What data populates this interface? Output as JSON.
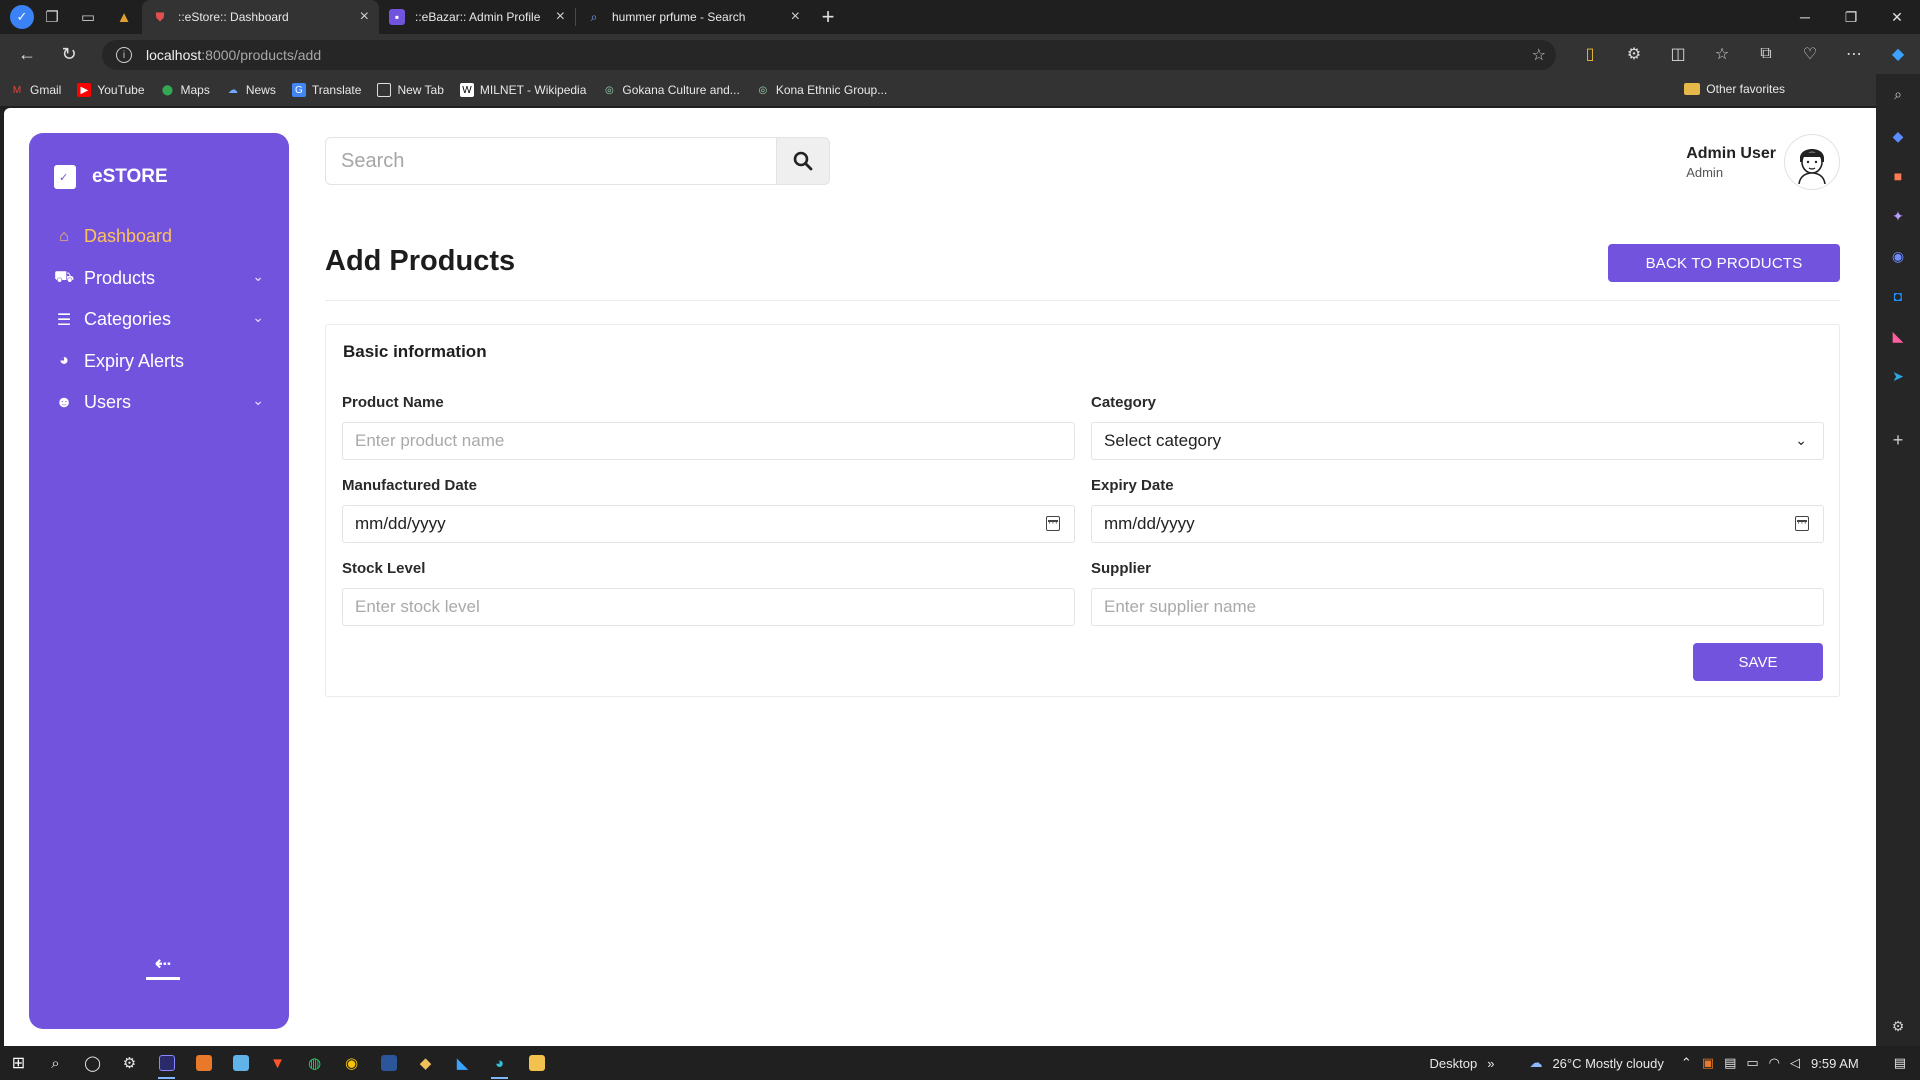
{
  "browser": {
    "tabs": [
      {
        "title": "::eStore:: Dashboard",
        "active": true
      },
      {
        "title": "::eBazar:: Admin Profile",
        "active": false
      },
      {
        "title": "hummer prfume - Search",
        "active": false
      }
    ],
    "url_host": "localhost",
    "url_rest": ":8000/products/add",
    "bookmarks": [
      "Gmail",
      "YouTube",
      "Maps",
      "News",
      "Translate",
      "New Tab",
      "MILNET - Wikipedia",
      "Gokana Culture and...",
      "Kona Ethnic Group..."
    ],
    "other_favorites": "Other favorites"
  },
  "sidebar": {
    "brand": "eSTORE",
    "items": [
      {
        "label": "Dashboard",
        "icon": "home-icon",
        "active": true,
        "expandable": false
      },
      {
        "label": "Products",
        "icon": "truck-icon",
        "active": false,
        "expandable": true
      },
      {
        "label": "Categories",
        "icon": "hierarchy-icon",
        "active": false,
        "expandable": true
      },
      {
        "label": "Expiry Alerts",
        "icon": "palette-icon",
        "active": false,
        "expandable": false
      },
      {
        "label": "Users",
        "icon": "user-icon",
        "active": false,
        "expandable": true
      }
    ]
  },
  "header": {
    "search_placeholder": "Search",
    "user_name": "Admin User",
    "user_role": "Admin"
  },
  "page": {
    "title": "Add Products",
    "back_label": "BACK TO PRODUCTS",
    "section_title": "Basic information",
    "fields": {
      "product_name": {
        "label": "Product Name",
        "placeholder": "Enter product name"
      },
      "category": {
        "label": "Category",
        "value": "Select category"
      },
      "manufactured_date": {
        "label": "Manufactured Date",
        "value": "mm/dd/yyyy"
      },
      "expiry_date": {
        "label": "Expiry Date",
        "value": "mm/dd/yyyy"
      },
      "stock_level": {
        "label": "Stock Level",
        "placeholder": "Enter stock level"
      },
      "supplier": {
        "label": "Supplier",
        "placeholder": "Enter supplier name"
      }
    },
    "save_label": "SAVE"
  },
  "taskbar": {
    "desktop_label": "Desktop",
    "weather": "26°C  Mostly cloudy",
    "time": "9:59 AM"
  },
  "colors": {
    "accent": "#7253de",
    "active_menu": "#ffc25c"
  }
}
